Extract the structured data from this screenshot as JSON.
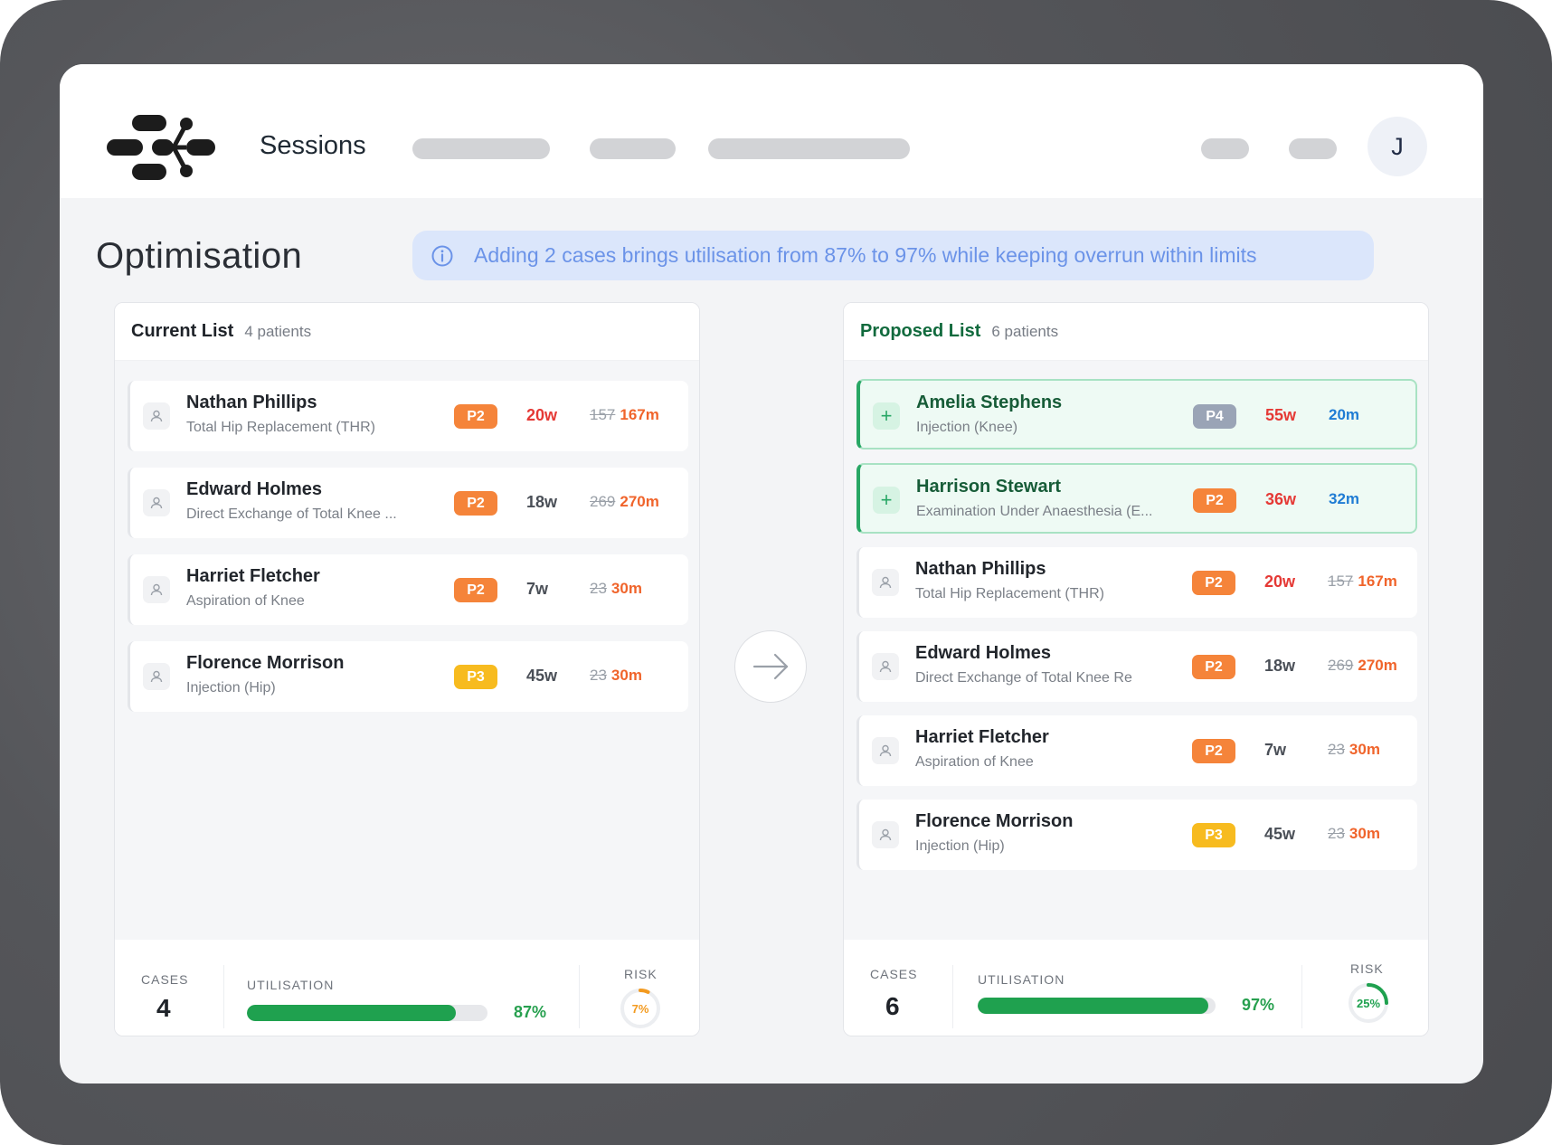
{
  "app": {
    "nav_title": "Sessions",
    "avatar_initial": "J"
  },
  "page": {
    "title": "Optimisation",
    "banner": "Adding 2 cases brings utilisation from 87% to 97% while keeping overrun within limits"
  },
  "colors": {
    "P2": "#f5843a",
    "P3": "#f7bb1f",
    "P4": "#9aa4b6",
    "utilisation": "#1fa14f",
    "risk_current": "#f39a1f",
    "risk_proposed": "#1fa14f"
  },
  "current": {
    "title": "Current List",
    "count": "4 patients",
    "rows": [
      {
        "name": "Nathan Phillips",
        "proc": "Total Hip Replacement (THR)",
        "priority": "P2",
        "wait": "20w",
        "wait_red": true,
        "dur_old": "157",
        "dur_new": "167m"
      },
      {
        "name": "Edward Holmes",
        "proc": "Direct Exchange of Total Knee ...",
        "priority": "P2",
        "wait": "18w",
        "wait_red": false,
        "dur_old": "269",
        "dur_new": "270m"
      },
      {
        "name": "Harriet Fletcher",
        "proc": "Aspiration of Knee",
        "priority": "P2",
        "wait": "7w",
        "wait_red": false,
        "dur_old": "23",
        "dur_new": "30m"
      },
      {
        "name": "Florence Morrison",
        "proc": "Injection (Hip)",
        "priority": "P3",
        "wait": "45w",
        "wait_red": false,
        "dur_old": "23",
        "dur_new": "30m"
      }
    ],
    "footer": {
      "cases_label": "CASES",
      "cases": "4",
      "util_label": "UTILISATION",
      "util_text": "87%",
      "util_value": 0.87,
      "risk_label": "RISK",
      "risk_text": "7%",
      "risk_value": 0.07
    }
  },
  "proposed": {
    "title": "Proposed List",
    "count": "6 patients",
    "rows": [
      {
        "added": true,
        "name": "Amelia Stephens",
        "proc": "Injection (Knee)",
        "priority": "P4",
        "wait": "55w",
        "wait_red": true,
        "dur": "20m"
      },
      {
        "added": true,
        "name": "Harrison Stewart",
        "proc": "Examination Under Anaesthesia (E...",
        "priority": "P2",
        "wait": "36w",
        "wait_red": true,
        "dur": "32m"
      },
      {
        "name": "Nathan Phillips",
        "proc": "Total Hip Replacement (THR)",
        "priority": "P2",
        "wait": "20w",
        "wait_red": true,
        "dur_old": "157",
        "dur_new": "167m"
      },
      {
        "name": "Edward Holmes",
        "proc": "Direct Exchange of Total Knee Re",
        "priority": "P2",
        "wait": "18w",
        "wait_red": false,
        "dur_old": "269",
        "dur_new": "270m"
      },
      {
        "name": "Harriet Fletcher",
        "proc": "Aspiration of Knee",
        "priority": "P2",
        "wait": "7w",
        "wait_red": false,
        "dur_old": "23",
        "dur_new": "30m"
      },
      {
        "name": "Florence Morrison",
        "proc": "Injection (Hip)",
        "priority": "P3",
        "wait": "45w",
        "wait_red": false,
        "dur_old": "23",
        "dur_new": "30m"
      }
    ],
    "footer": {
      "cases_label": "CASES",
      "cases": "6",
      "util_label": "UTILISATION",
      "util_text": "97%",
      "util_value": 0.97,
      "risk_label": "RISK",
      "risk_text": "25%",
      "risk_value": 0.25
    }
  }
}
